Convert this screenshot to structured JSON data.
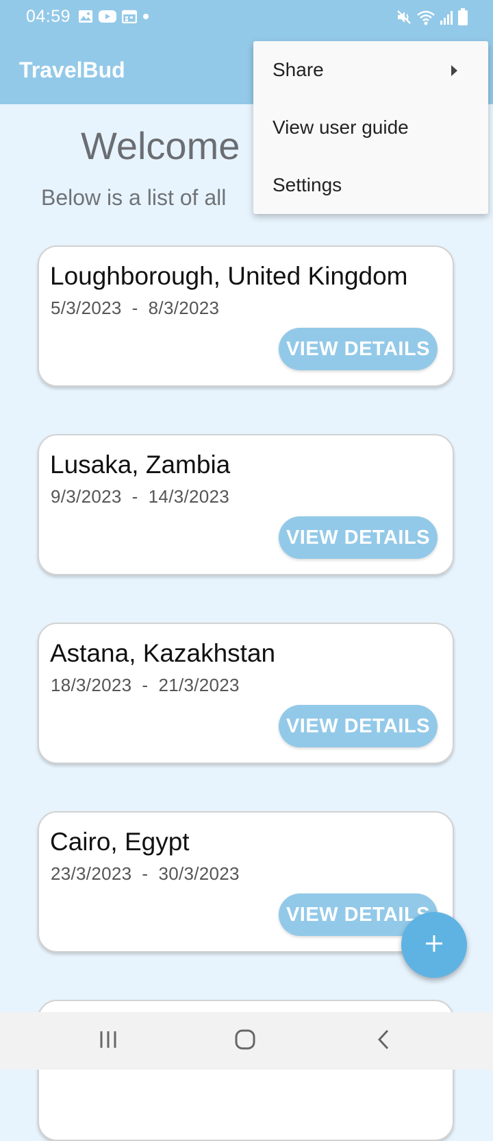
{
  "status_bar": {
    "time": "04:59",
    "left_icons": [
      "image-icon",
      "youtube-icon",
      "calendar-icon",
      "dot-icon"
    ],
    "right_icons": [
      "mute-icon",
      "wifi-icon",
      "signal-icon",
      "battery-icon"
    ]
  },
  "app_bar": {
    "title": "TravelBud"
  },
  "main": {
    "welcome": "Welcome",
    "subtitle": "Below is a list of all"
  },
  "trips": [
    {
      "location": "Loughborough, United Kingdom",
      "start": "5/3/2023",
      "end": "8/3/2023",
      "button": "VIEW DETAILS"
    },
    {
      "location": "Lusaka, Zambia",
      "start": "9/3/2023",
      "end": "14/3/2023",
      "button": "VIEW DETAILS"
    },
    {
      "location": "Astana, Kazakhstan",
      "start": "18/3/2023",
      "end": "21/3/2023",
      "button": "VIEW DETAILS"
    },
    {
      "location": "Cairo, Egypt",
      "start": "23/3/2023",
      "end": "30/3/2023",
      "button": "VIEW DETAILS"
    }
  ],
  "date_separator": "  -  ",
  "fab": {
    "icon": "plus-icon"
  },
  "menu": {
    "items": [
      {
        "label": "Share",
        "has_submenu": true
      },
      {
        "label": "View user guide",
        "has_submenu": false
      },
      {
        "label": "Settings",
        "has_submenu": false
      }
    ]
  },
  "nav_bar": {
    "buttons": [
      "recents-icon",
      "home-icon",
      "back-icon"
    ]
  },
  "colors": {
    "accent": "#93c9e8",
    "background": "#e8f4fd",
    "fab": "#5eb3e3",
    "menu_background": "#f9f9f9"
  }
}
